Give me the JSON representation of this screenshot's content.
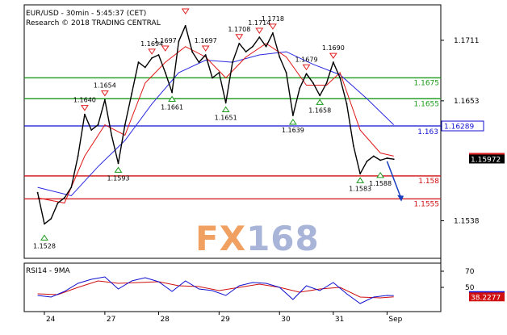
{
  "header": {
    "line1": "EUR/USD - 30min - 5:45:37 (CET)",
    "line2": "Research © 2018 TRADING CENTRAL"
  },
  "watermark": {
    "part1": "FX",
    "part2": "168"
  },
  "rsi_label": "RSI14 - 9MA",
  "chart_data": {
    "type": "line",
    "title": "EUR/USD - 30min - 5:45:37 (CET)",
    "price_axis": {
      "ylim": [
        1.1502,
        1.1745
      ],
      "ticks": [
        1.1711,
        1.1653,
        1.1538
      ]
    },
    "x_labels": [
      {
        "label": "24",
        "pos": 1
      },
      {
        "label": "27",
        "pos": 10
      },
      {
        "label": "28",
        "pos": 18
      },
      {
        "label": "29",
        "pos": 27
      },
      {
        "label": "30",
        "pos": 36
      },
      {
        "label": "31",
        "pos": 44
      },
      {
        "label": "Sep",
        "pos": 52
      }
    ],
    "x_range": [
      -2,
      60
    ],
    "price_series": [
      {
        "pos": 0,
        "value": 1.1565
      },
      {
        "pos": 1,
        "value": 1.1535
      },
      {
        "pos": 2,
        "value": 1.154
      },
      {
        "pos": 3,
        "value": 1.1555
      },
      {
        "pos": 4,
        "value": 1.156
      },
      {
        "pos": 5,
        "value": 1.157
      },
      {
        "pos": 6,
        "value": 1.16
      },
      {
        "pos": 7,
        "value": 1.164
      },
      {
        "pos": 8,
        "value": 1.1625
      },
      {
        "pos": 9,
        "value": 1.163
      },
      {
        "pos": 10,
        "value": 1.1654
      },
      {
        "pos": 11,
        "value": 1.162
      },
      {
        "pos": 12,
        "value": 1.1593
      },
      {
        "pos": 13,
        "value": 1.163
      },
      {
        "pos": 14,
        "value": 1.166
      },
      {
        "pos": 15,
        "value": 1.169
      },
      {
        "pos": 16,
        "value": 1.1685
      },
      {
        "pos": 17,
        "value": 1.1694
      },
      {
        "pos": 18,
        "value": 1.1697
      },
      {
        "pos": 19,
        "value": 1.168
      },
      {
        "pos": 20,
        "value": 1.1661
      },
      {
        "pos": 21,
        "value": 1.171
      },
      {
        "pos": 22,
        "value": 1.1725
      },
      {
        "pos": 23,
        "value": 1.17
      },
      {
        "pos": 24,
        "value": 1.169
      },
      {
        "pos": 25,
        "value": 1.1697
      },
      {
        "pos": 26,
        "value": 1.1675
      },
      {
        "pos": 27,
        "value": 1.168
      },
      {
        "pos": 28,
        "value": 1.1651
      },
      {
        "pos": 29,
        "value": 1.169
      },
      {
        "pos": 30,
        "value": 1.1708
      },
      {
        "pos": 31,
        "value": 1.17
      },
      {
        "pos": 32,
        "value": 1.1705
      },
      {
        "pos": 33,
        "value": 1.1714
      },
      {
        "pos": 34,
        "value": 1.1705
      },
      {
        "pos": 35,
        "value": 1.1718
      },
      {
        "pos": 36,
        "value": 1.1695
      },
      {
        "pos": 37,
        "value": 1.168
      },
      {
        "pos": 38,
        "value": 1.1639
      },
      {
        "pos": 39,
        "value": 1.1665
      },
      {
        "pos": 40,
        "value": 1.1679
      },
      {
        "pos": 41,
        "value": 1.167
      },
      {
        "pos": 42,
        "value": 1.1658
      },
      {
        "pos": 43,
        "value": 1.167
      },
      {
        "pos": 44,
        "value": 1.169
      },
      {
        "pos": 45,
        "value": 1.1675
      },
      {
        "pos": 46,
        "value": 1.165
      },
      {
        "pos": 47,
        "value": 1.161
      },
      {
        "pos": 48,
        "value": 1.1583
      },
      {
        "pos": 49,
        "value": 1.1595
      },
      {
        "pos": 50,
        "value": 1.16
      },
      {
        "pos": 51,
        "value": 1.1596
      },
      {
        "pos": 52,
        "value": 1.1598
      },
      {
        "pos": 53,
        "value": 1.1597
      }
    ],
    "ma_fast": [
      {
        "pos": 0,
        "value": 1.156
      },
      {
        "pos": 4,
        "value": 1.1555
      },
      {
        "pos": 7,
        "value": 1.16
      },
      {
        "pos": 10,
        "value": 1.163
      },
      {
        "pos": 13,
        "value": 1.162
      },
      {
        "pos": 16,
        "value": 1.167
      },
      {
        "pos": 19,
        "value": 1.169
      },
      {
        "pos": 22,
        "value": 1.1705
      },
      {
        "pos": 25,
        "value": 1.1695
      },
      {
        "pos": 28,
        "value": 1.1675
      },
      {
        "pos": 31,
        "value": 1.1695
      },
      {
        "pos": 34,
        "value": 1.1708
      },
      {
        "pos": 37,
        "value": 1.1695
      },
      {
        "pos": 40,
        "value": 1.1668
      },
      {
        "pos": 43,
        "value": 1.1668
      },
      {
        "pos": 45,
        "value": 1.168
      },
      {
        "pos": 48,
        "value": 1.1625
      },
      {
        "pos": 51,
        "value": 1.1603
      },
      {
        "pos": 53,
        "value": 1.16
      }
    ],
    "ma_slow": [
      {
        "pos": 0,
        "value": 1.157
      },
      {
        "pos": 5,
        "value": 1.1562
      },
      {
        "pos": 9,
        "value": 1.159
      },
      {
        "pos": 13,
        "value": 1.1615
      },
      {
        "pos": 17,
        "value": 1.165
      },
      {
        "pos": 21,
        "value": 1.168
      },
      {
        "pos": 25,
        "value": 1.1692
      },
      {
        "pos": 29,
        "value": 1.169
      },
      {
        "pos": 33,
        "value": 1.1697
      },
      {
        "pos": 37,
        "value": 1.17
      },
      {
        "pos": 41,
        "value": 1.1688
      },
      {
        "pos": 45,
        "value": 1.1678
      },
      {
        "pos": 49,
        "value": 1.1655
      },
      {
        "pos": 53,
        "value": 1.163
      }
    ],
    "levels": [
      {
        "name": "resistance-1675",
        "value": 1.1675,
        "label": "1.1675",
        "color": "#1a9a1a",
        "box": false
      },
      {
        "name": "resistance-1655",
        "value": 1.1655,
        "label": "1.1655",
        "color": "#1a9a1a",
        "box": false
      },
      {
        "name": "pivot-16289",
        "value": 1.16289,
        "label": "1.16289",
        "color": "#1010d0",
        "box": true,
        "box_fill": "#ffffff",
        "text_color": "#1010d0",
        "line_label": "1.163",
        "line_label_color": "#1010d0"
      },
      {
        "name": "support-158",
        "value": 1.1581,
        "label": "1.158",
        "color": "#d01010",
        "box": false
      },
      {
        "name": "support-1555",
        "value": 1.1559,
        "label": "1.1555",
        "color": "#d01010",
        "box": false
      }
    ],
    "price_tags": [
      {
        "name": "high-tag",
        "value": 1.15988,
        "label": "1.15988",
        "fill": "#e02020",
        "text": "#ffffff"
      },
      {
        "name": "last-price-tag",
        "value": 1.15972,
        "label": "1.15972",
        "fill": "#000000",
        "text": "#ffffff"
      }
    ],
    "annotations": [
      {
        "label": "1.1528",
        "pos": 1,
        "value": 1.1528,
        "kind": "low"
      },
      {
        "label": "1.1640",
        "pos": 7,
        "value": 1.164,
        "kind": "high"
      },
      {
        "label": "1.1654",
        "pos": 10,
        "value": 1.1654,
        "kind": "high"
      },
      {
        "label": "1.1593",
        "pos": 12,
        "value": 1.1593,
        "kind": "low"
      },
      {
        "label": "1.1694",
        "pos": 17,
        "value": 1.1694,
        "kind": "high"
      },
      {
        "label": "1.1697",
        "pos": 19,
        "value": 1.1697,
        "kind": "high"
      },
      {
        "label": "1.1661",
        "pos": 20,
        "value": 1.1661,
        "kind": "low"
      },
      {
        "label": "1.1697",
        "pos": 25,
        "value": 1.1697,
        "kind": "high"
      },
      {
        "label": "1.1651",
        "pos": 28,
        "value": 1.1651,
        "kind": "low"
      },
      {
        "label": "1.1708",
        "pos": 30,
        "value": 1.1708,
        "kind": "high"
      },
      {
        "label": "1.1714",
        "pos": 33,
        "value": 1.1714,
        "kind": "high"
      },
      {
        "label": "1.1718",
        "pos": 35,
        "value": 1.1718,
        "kind": "high"
      },
      {
        "label": "1.1639",
        "pos": 38,
        "value": 1.1639,
        "kind": "low"
      },
      {
        "label": "1.1679",
        "pos": 40,
        "value": 1.1679,
        "kind": "high"
      },
      {
        "label": "1.1658",
        "pos": 42,
        "value": 1.1658,
        "kind": "low"
      },
      {
        "label": "1.1690",
        "pos": 44,
        "value": 1.169,
        "kind": "high"
      },
      {
        "label": "1.1583",
        "pos": 48,
        "value": 1.1583,
        "kind": "low"
      },
      {
        "label": "1.1588",
        "pos": 51,
        "value": 1.1588,
        "kind": "low"
      }
    ],
    "top_marker": {
      "pos": 22,
      "value": 1.174,
      "kind": "high"
    },
    "projection": {
      "from": {
        "pos": 52,
        "value": 1.1595
      },
      "to": {
        "pos": 54,
        "value": 1.1558
      },
      "color": "#1a3fbf"
    },
    "rsi": {
      "ylim": [
        20,
        80
      ],
      "ticks": [
        70,
        50
      ],
      "tags": [
        {
          "name": "rsi-value-tag",
          "value": 39.7846,
          "label": "39.7846",
          "fill": "#1010d0",
          "text": "#ffffff"
        },
        {
          "name": "rsi-ma-tag",
          "value": 38.2277,
          "label": "38.2277",
          "fill": "#d01010",
          "text": "#ffffff"
        }
      ],
      "rsi_values": [
        {
          "pos": 0,
          "value": 40
        },
        {
          "pos": 2,
          "value": 38
        },
        {
          "pos": 4,
          "value": 45
        },
        {
          "pos": 6,
          "value": 55
        },
        {
          "pos": 8,
          "value": 60
        },
        {
          "pos": 10,
          "value": 63
        },
        {
          "pos": 12,
          "value": 48
        },
        {
          "pos": 14,
          "value": 58
        },
        {
          "pos": 16,
          "value": 62
        },
        {
          "pos": 18,
          "value": 57
        },
        {
          "pos": 20,
          "value": 45
        },
        {
          "pos": 22,
          "value": 58
        },
        {
          "pos": 24,
          "value": 48
        },
        {
          "pos": 26,
          "value": 46
        },
        {
          "pos": 28,
          "value": 40
        },
        {
          "pos": 30,
          "value": 52
        },
        {
          "pos": 32,
          "value": 56
        },
        {
          "pos": 34,
          "value": 55
        },
        {
          "pos": 36,
          "value": 50
        },
        {
          "pos": 38,
          "value": 35
        },
        {
          "pos": 40,
          "value": 52
        },
        {
          "pos": 42,
          "value": 46
        },
        {
          "pos": 44,
          "value": 56
        },
        {
          "pos": 46,
          "value": 42
        },
        {
          "pos": 48,
          "value": 30
        },
        {
          "pos": 50,
          "value": 38
        },
        {
          "pos": 52,
          "value": 40
        },
        {
          "pos": 53,
          "value": 39.8
        }
      ],
      "ma_values": [
        {
          "pos": 0,
          "value": 42
        },
        {
          "pos": 3,
          "value": 41
        },
        {
          "pos": 6,
          "value": 50
        },
        {
          "pos": 9,
          "value": 58
        },
        {
          "pos": 12,
          "value": 55
        },
        {
          "pos": 15,
          "value": 56
        },
        {
          "pos": 18,
          "value": 57
        },
        {
          "pos": 21,
          "value": 52
        },
        {
          "pos": 24,
          "value": 51
        },
        {
          "pos": 27,
          "value": 46
        },
        {
          "pos": 30,
          "value": 50
        },
        {
          "pos": 33,
          "value": 54
        },
        {
          "pos": 36,
          "value": 50
        },
        {
          "pos": 39,
          "value": 44
        },
        {
          "pos": 42,
          "value": 48
        },
        {
          "pos": 45,
          "value": 50
        },
        {
          "pos": 48,
          "value": 38
        },
        {
          "pos": 51,
          "value": 37
        },
        {
          "pos": 53,
          "value": 38.2
        }
      ]
    },
    "colors": {
      "price": "#000000",
      "ma_fast": "#e01818",
      "ma_slow": "#2a2ae0",
      "rsi": "#1010d0",
      "rsi_ma": "#d01010",
      "watermark_fx": "#f0a060",
      "watermark_num": "#a8b4d8"
    }
  }
}
